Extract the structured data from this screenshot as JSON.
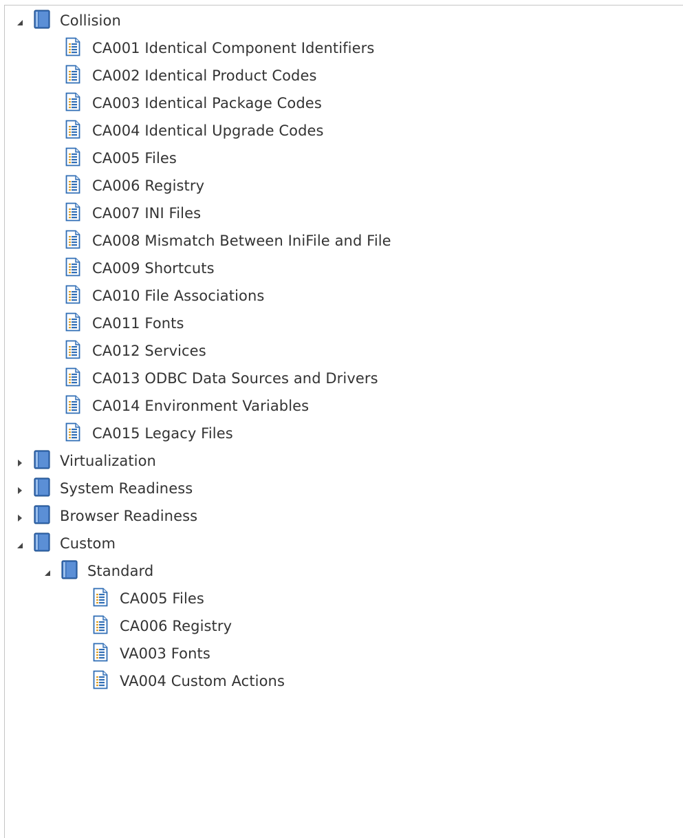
{
  "tree": {
    "collision": {
      "label": "Collision",
      "children": [
        "CA001 Identical Component Identifiers",
        "CA002 Identical Product Codes",
        "CA003 Identical Package Codes",
        "CA004 Identical Upgrade Codes",
        "CA005 Files",
        "CA006 Registry",
        "CA007 INI Files",
        "CA008 Mismatch Between IniFile and File",
        "CA009 Shortcuts",
        "CA010 File Associations",
        "CA011 Fonts",
        "CA012 Services",
        "CA013 ODBC Data Sources and Drivers",
        "CA014 Environment Variables",
        "CA015 Legacy Files"
      ]
    },
    "virtualization": {
      "label": "Virtualization"
    },
    "system_readiness": {
      "label": "System Readiness"
    },
    "browser_readiness": {
      "label": "Browser Readiness"
    },
    "custom": {
      "label": "Custom",
      "standard": {
        "label": "Standard",
        "children": [
          "CA005 Files",
          "CA006 Registry",
          "VA003 Fonts",
          "VA004 Custom Actions"
        ]
      }
    }
  },
  "icons": {
    "folder": "book-folder-icon",
    "rule": "rule-document-icon",
    "expanded": "expanded-arrow-icon",
    "collapsed": "collapsed-arrow-icon"
  },
  "colors": {
    "folder_blue": "#3a6fb8",
    "rule_blue": "#2f6db5",
    "text": "#333333"
  }
}
